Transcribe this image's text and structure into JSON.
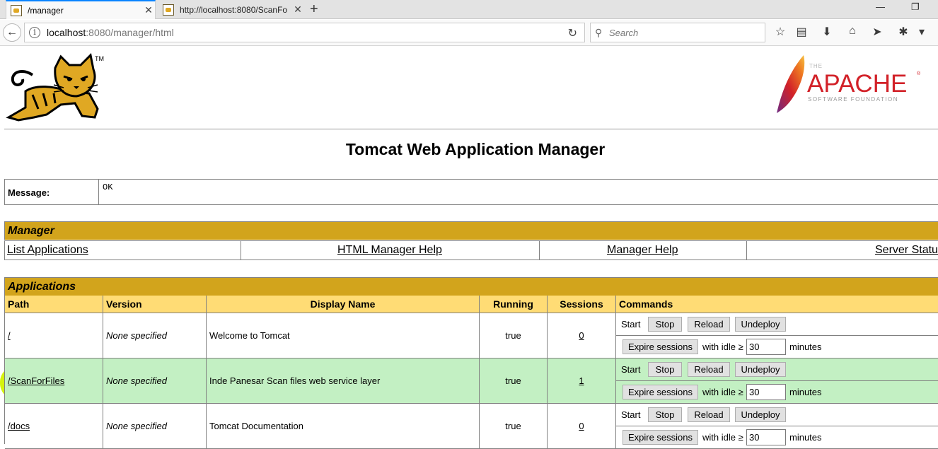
{
  "browser": {
    "tabs": [
      {
        "title": "/manager",
        "active": true
      },
      {
        "title": "http://localhost:8080/ScanFo",
        "active": false
      }
    ],
    "url_host": "localhost",
    "url_rest": ":8080/manager/html",
    "search_placeholder": "Search"
  },
  "page": {
    "title": "Tomcat Web Application Manager",
    "tomcat_tm": "TM",
    "apache": {
      "the": "THE",
      "name": "APACHE",
      "sub": "SOFTWARE FOUNDATION",
      "reg": "®"
    }
  },
  "message": {
    "label": "Message:",
    "value": "OK"
  },
  "manager": {
    "heading": "Manager",
    "links": [
      "List Applications",
      "HTML Manager Help",
      "Manager Help",
      "Server Status"
    ]
  },
  "applications": {
    "heading": "Applications",
    "columns": [
      "Path",
      "Version",
      "Display Name",
      "Running",
      "Sessions",
      "Commands"
    ],
    "commands": {
      "start": "Start",
      "stop": "Stop",
      "reload": "Reload",
      "undeploy": "Undeploy",
      "expire": "Expire sessions",
      "with_idle": "with idle ≥",
      "minutes": "minutes"
    },
    "rows": [
      {
        "path": "/",
        "version": "None specified",
        "display_name": "Welcome to Tomcat",
        "running": "true",
        "sessions": "0",
        "idle": "30",
        "highlight": false
      },
      {
        "path": "/ScanForFiles",
        "version": "None specified",
        "display_name": "Inde Panesar Scan files web service layer",
        "running": "true",
        "sessions": "1",
        "idle": "30",
        "highlight": true
      },
      {
        "path": "/docs",
        "version": "None specified",
        "display_name": "Tomcat Documentation",
        "running": "true",
        "sessions": "0",
        "idle": "30",
        "highlight": false
      }
    ]
  },
  "colors": {
    "section_header": "#d2a41c",
    "column_header": "#ffdc75",
    "row_green": "#c3f0c3",
    "marker_highlight": "#d3f200",
    "apache_red": "#d22128"
  },
  "icons": [
    "tomcat-favicon",
    "close-icon",
    "plus-icon",
    "minimize-icon",
    "restore-icon",
    "back-arrow-icon",
    "info-icon",
    "reload-icon",
    "search-icon",
    "star-icon",
    "reading-list-icon",
    "download-icon",
    "home-icon",
    "send-icon",
    "extension-icon",
    "menu-chevron-icon"
  ]
}
